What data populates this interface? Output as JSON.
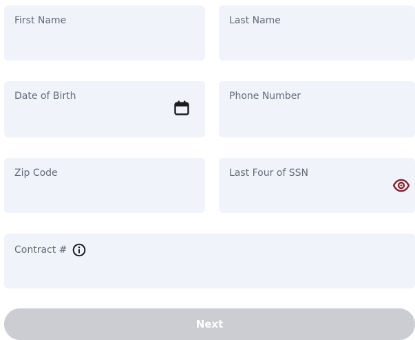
{
  "form": {
    "first_name": {
      "label": "First Name",
      "value": ""
    },
    "last_name": {
      "label": "Last Name",
      "value": ""
    },
    "date_of_birth": {
      "label": "Date of Birth",
      "value": "",
      "icon": "calendar-icon"
    },
    "phone_number": {
      "label": "Phone Number",
      "value": ""
    },
    "zip_code": {
      "label": "Zip Code",
      "value": ""
    },
    "ssn_last_four": {
      "label": "Last Four of SSN",
      "value": "",
      "icon": "eye-icon"
    },
    "contract_number": {
      "label": "Contract #",
      "value": "",
      "icon": "info-icon"
    }
  },
  "actions": {
    "next_label": "Next",
    "next_enabled": false
  },
  "colors": {
    "field_background": "#f0f3fa",
    "label_text": "#646b78",
    "eye_icon": "#8b2331",
    "icon_dark": "#1c1c1c",
    "button_disabled": "#cbcdd3",
    "button_text": "#ffffff"
  }
}
